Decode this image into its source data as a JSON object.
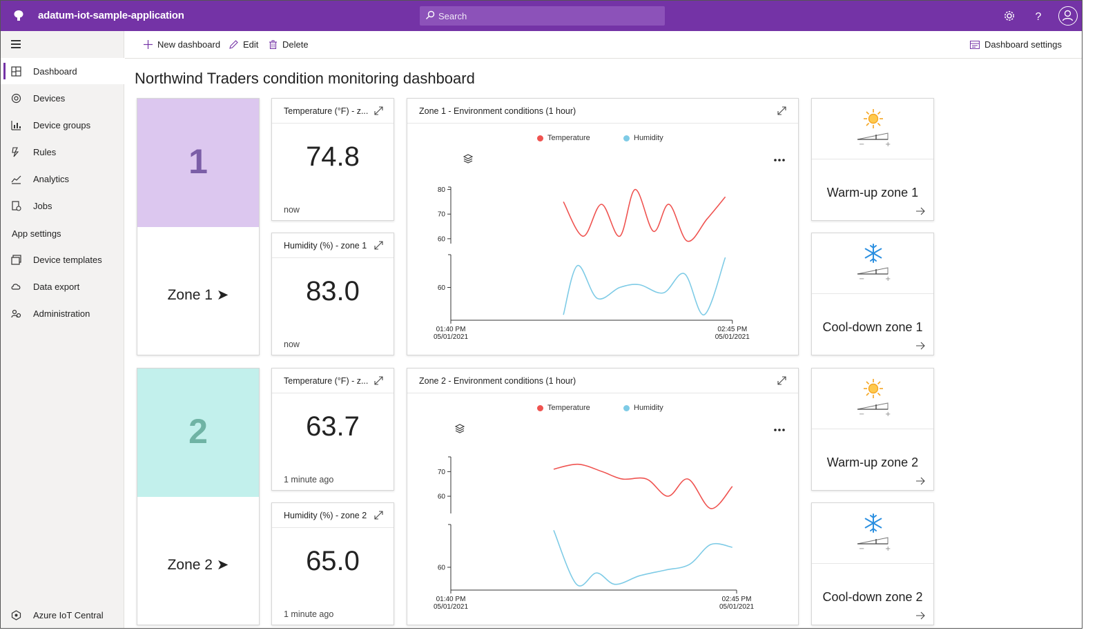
{
  "app": {
    "title": "adatum-iot-sample-application"
  },
  "search": {
    "placeholder": "Search"
  },
  "sidebar": {
    "items": [
      {
        "label": "Dashboard",
        "icon": "dashboard-icon",
        "active": true
      },
      {
        "label": "Devices",
        "icon": "devices-icon"
      },
      {
        "label": "Device groups",
        "icon": "device-groups-icon"
      },
      {
        "label": "Rules",
        "icon": "rules-icon"
      },
      {
        "label": "Analytics",
        "icon": "analytics-icon"
      },
      {
        "label": "Jobs",
        "icon": "jobs-icon"
      }
    ],
    "section_app_settings": "App settings",
    "settings_items": [
      {
        "label": "Device templates",
        "icon": "device-templates-icon"
      },
      {
        "label": "Data export",
        "icon": "data-export-icon"
      },
      {
        "label": "Administration",
        "icon": "administration-icon"
      }
    ],
    "footer": "Azure IoT Central"
  },
  "commands": {
    "new_dashboard": "New dashboard",
    "edit": "Edit",
    "delete": "Delete",
    "dashboard_settings": "Dashboard settings"
  },
  "page": {
    "title": "Northwind Traders condition monitoring dashboard"
  },
  "zones": [
    {
      "number": "1",
      "label": "Zone 1 ➤",
      "color": "#dcc7ef",
      "number_color": "#7b5ea7",
      "temperature": {
        "title": "Temperature (°F) - z...",
        "value": "74.8",
        "time": "now"
      },
      "humidity": {
        "title": "Humidity (%) - zone 1",
        "value": "83.0",
        "time": "now"
      },
      "chart_title": "Zone 1 - Environment conditions (1 hour)",
      "warmup": "Warm-up zone 1",
      "cooldown": "Cool-down zone 1"
    },
    {
      "number": "2",
      "label": "Zone 2 ➤",
      "color": "#c2f0ec",
      "number_color": "#6fb3a4",
      "temperature": {
        "title": "Temperature (°F) - z...",
        "value": "63.7",
        "time": "1 minute ago"
      },
      "humidity": {
        "title": "Humidity (%) - zone 2",
        "value": "65.0",
        "time": "1 minute ago"
      },
      "chart_title": "Zone 2 - Environment conditions (1 hour)",
      "warmup": "Warm-up zone 2",
      "cooldown": "Cool-down zone 2"
    }
  ],
  "legend": {
    "temperature": "Temperature",
    "humidity": "Humidity",
    "temperature_color": "#ef5350",
    "humidity_color": "#7ecbe6"
  },
  "chart_data": [
    {
      "type": "line",
      "title": "Zone 1 - Environment conditions (1 hour)",
      "x_start": "01:40 PM 05/01/2021",
      "x_end": "02:45 PM 05/01/2021",
      "x_tick_labels": [
        [
          "01:40 PM",
          "05/01/2021"
        ],
        [
          "02:45 PM",
          "05/01/2021"
        ]
      ],
      "series": [
        {
          "name": "Temperature",
          "color": "#ef5350",
          "yticks": [
            60,
            70,
            80
          ],
          "ylim": [
            58,
            81
          ],
          "x": [
            0.4,
            0.47,
            0.535,
            0.6,
            0.655,
            0.72,
            0.775,
            0.84,
            0.91,
            0.975
          ],
          "values": [
            75,
            61,
            74,
            61,
            80,
            63,
            74,
            59,
            68,
            77
          ]
        },
        {
          "name": "Humidity",
          "color": "#7ecbe6",
          "yticks": [
            60
          ],
          "ylim": [
            48,
            72
          ],
          "x": [
            0.4,
            0.45,
            0.52,
            0.6,
            0.67,
            0.755,
            0.83,
            0.9,
            0.975
          ],
          "values": [
            50,
            68,
            56,
            60,
            61,
            58,
            65,
            50,
            71
          ]
        }
      ]
    },
    {
      "type": "line",
      "title": "Zone 2 - Environment conditions (1 hour)",
      "x_start": "01:40 PM 05/01/2021",
      "x_end": "02:45 PM 05/01/2021",
      "x_tick_labels": [
        [
          "01:40 PM",
          "05/01/2021"
        ],
        [
          "02:45 PM",
          "05/01/2021"
        ]
      ],
      "series": [
        {
          "name": "Temperature",
          "color": "#ef5350",
          "yticks": [
            60,
            70
          ],
          "ylim": [
            53,
            76
          ],
          "x": [
            0.36,
            0.445,
            0.53,
            0.6,
            0.685,
            0.76,
            0.83,
            0.91,
            0.985
          ],
          "values": [
            71,
            73,
            70,
            67,
            67,
            60,
            67,
            55,
            64
          ]
        },
        {
          "name": "Humidity",
          "color": "#7ecbe6",
          "yticks": [
            60
          ],
          "ylim": [
            52,
            75
          ],
          "x": [
            0.36,
            0.44,
            0.51,
            0.575,
            0.66,
            0.75,
            0.835,
            0.91,
            0.985
          ],
          "values": [
            73,
            54,
            58,
            54,
            57,
            59,
            61,
            68,
            67
          ]
        }
      ]
    }
  ]
}
